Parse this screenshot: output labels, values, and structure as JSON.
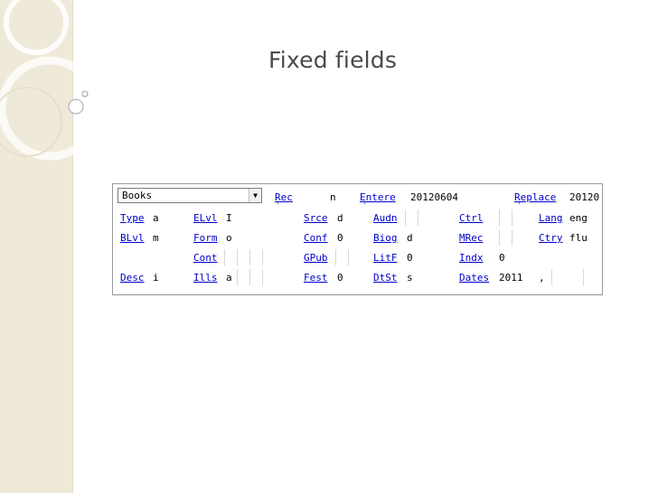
{
  "slide": {
    "title": "Fixed fields"
  },
  "fixed_fields": {
    "format_select": {
      "value": "Books"
    },
    "header": [
      {
        "label": "Rec",
        "value": "n"
      },
      {
        "label": "Entere",
        "value": "20120604"
      },
      {
        "label": "Replace",
        "value": "20120"
      }
    ],
    "rows": [
      [
        {
          "label": "Type",
          "value": "a"
        },
        {
          "label": "ELvl",
          "value": "I"
        },
        {
          "label": "Srce",
          "value": "d"
        },
        {
          "label": "Audn",
          "value": ""
        },
        {
          "label": "Ctrl",
          "value": ""
        },
        {
          "label": "Lang",
          "value": "eng"
        }
      ],
      [
        {
          "label": "BLvl",
          "value": "m"
        },
        {
          "label": "Form",
          "value": "o"
        },
        {
          "label": "Conf",
          "value": "0"
        },
        {
          "label": "Biog",
          "value": "d"
        },
        {
          "label": "MRec",
          "value": ""
        },
        {
          "label": "Ctry",
          "value": "flu"
        }
      ],
      [
        {
          "label": "",
          "value": ""
        },
        {
          "label": "Cont",
          "value": ""
        },
        {
          "label": "GPub",
          "value": ""
        },
        {
          "label": "LitF",
          "value": "0"
        },
        {
          "label": "Indx",
          "value": "0"
        },
        {
          "label": "",
          "value": ""
        }
      ],
      [
        {
          "label": "Desc",
          "value": "i"
        },
        {
          "label": "Ills",
          "value": "a"
        },
        {
          "label": "Fest",
          "value": "0"
        },
        {
          "label": "DtSt",
          "value": "s"
        },
        {
          "label": "Dates",
          "value": "2011"
        },
        {
          "label": "",
          "value": ","
        }
      ]
    ]
  }
}
